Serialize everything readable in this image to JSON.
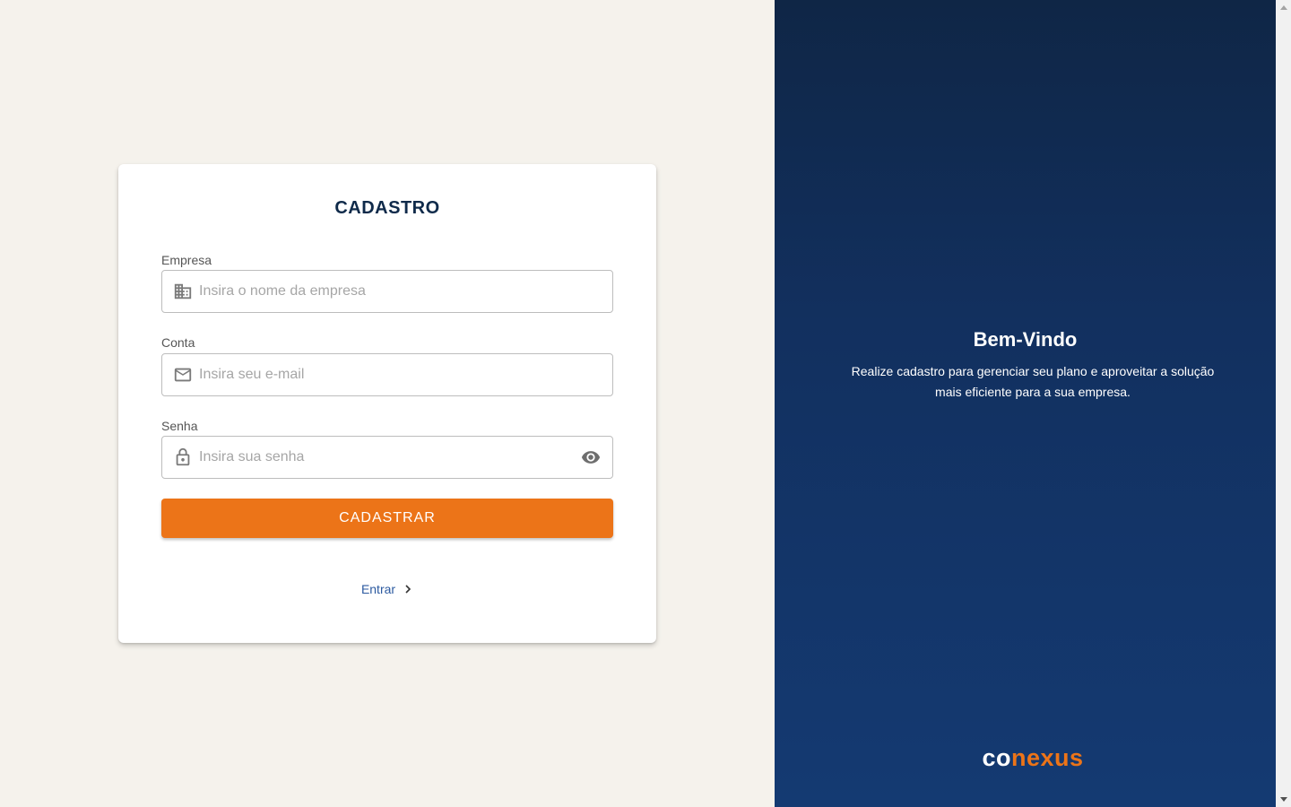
{
  "form": {
    "title": "CADASTRO",
    "company": {
      "label": "Empresa",
      "placeholder": "Insira o nome da empresa",
      "icon": "building-icon"
    },
    "account": {
      "label": "Conta",
      "placeholder": "Insira seu e-mail",
      "icon": "mail-icon"
    },
    "password": {
      "label": "Senha",
      "placeholder": "Insira sua senha",
      "icon": "lock-icon",
      "toggle_icon": "eye-icon"
    },
    "submit_label": "CADASTRAR",
    "login_link": "Entrar"
  },
  "welcome": {
    "title": "Bem-Vindo",
    "text": "Realize cadastro para gerenciar seu plano e aproveitar a solução mais eficiente para a sua empresa."
  },
  "logo": {
    "part1": "co",
    "part2": "nexus"
  },
  "colors": {
    "accent": "#ec7418",
    "navy": "#0f2a4a",
    "link": "#2c5aa0",
    "background": "#f5f2ec"
  }
}
